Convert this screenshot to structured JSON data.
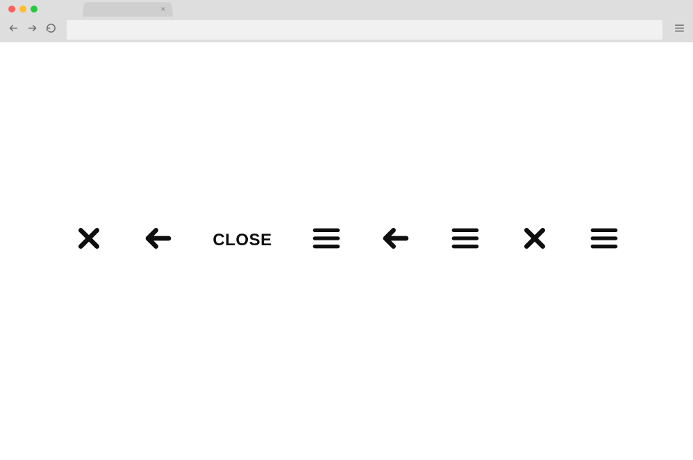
{
  "browser": {
    "tab_close_glyph": "×"
  },
  "content": {
    "close_label": "CLOSE"
  }
}
